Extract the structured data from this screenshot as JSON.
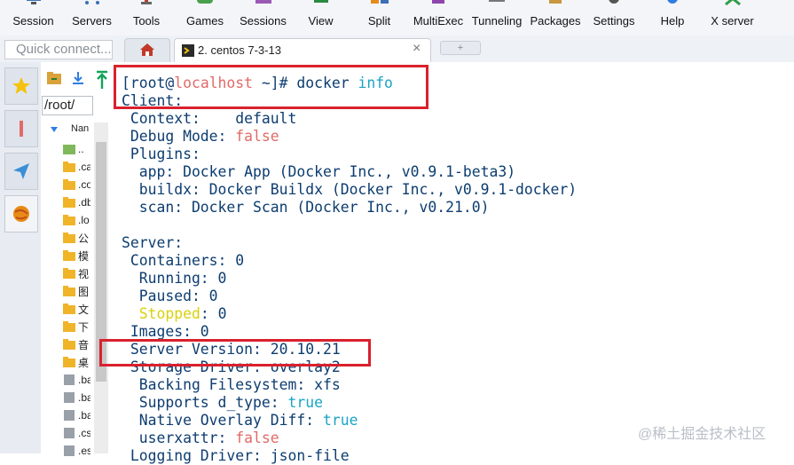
{
  "toolbar": {
    "items": [
      {
        "label": "Session",
        "icon": "session-icon"
      },
      {
        "label": "Servers",
        "icon": "servers-icon"
      },
      {
        "label": "Tools",
        "icon": "tools-icon"
      },
      {
        "label": "Games",
        "icon": "games-icon"
      },
      {
        "label": "Sessions",
        "icon": "sessions-icon"
      },
      {
        "label": "View",
        "icon": "view-icon"
      },
      {
        "label": "Split",
        "icon": "split-icon"
      },
      {
        "label": "MultiExec",
        "icon": "multiexec-icon"
      },
      {
        "label": "Tunneling",
        "icon": "tunneling-icon"
      },
      {
        "label": "Packages",
        "icon": "packages-icon"
      },
      {
        "label": "Settings",
        "icon": "settings-icon"
      },
      {
        "label": "Help",
        "icon": "help-icon"
      },
      {
        "label": "X server",
        "icon": "x-server-icon"
      }
    ]
  },
  "quick_connect": {
    "placeholder": "Quick connect..."
  },
  "tabs": {
    "home_icon": "home-icon",
    "active_title": "2. centos 7-3-13",
    "close": "×",
    "new_tab": "+"
  },
  "file_browser": {
    "path": "/root/",
    "column_name": "Nan",
    "files": [
      {
        "name": "..",
        "icon": "parent-folder-icon"
      },
      {
        "name": ".ca",
        "icon": "folder-icon"
      },
      {
        "name": ".co",
        "icon": "folder-icon"
      },
      {
        "name": ".db",
        "icon": "folder-icon"
      },
      {
        "name": ".lo",
        "icon": "folder-icon"
      },
      {
        "name": "公",
        "icon": "folder-icon"
      },
      {
        "name": "模",
        "icon": "folder-icon"
      },
      {
        "name": "视",
        "icon": "folder-icon"
      },
      {
        "name": "图",
        "icon": "folder-icon"
      },
      {
        "name": "文",
        "icon": "folder-icon"
      },
      {
        "name": "下",
        "icon": "folder-icon"
      },
      {
        "name": "音",
        "icon": "folder-icon"
      },
      {
        "name": "桌",
        "icon": "folder-icon"
      },
      {
        "name": ".ba",
        "icon": "file-icon"
      },
      {
        "name": ".ba",
        "icon": "file-icon"
      },
      {
        "name": ".ba",
        "icon": "file-icon"
      },
      {
        "name": ".cs",
        "icon": "file-icon"
      },
      {
        "name": ".es",
        "icon": "file-icon"
      }
    ]
  },
  "terminal": {
    "lines": [
      [
        {
          "t": "[root@"
        },
        {
          "t": "localhost",
          "c": "host"
        },
        {
          "t": " ~]# docker "
        },
        {
          "t": "info",
          "c": "cyan"
        }
      ],
      [
        {
          "t": "Client:"
        }
      ],
      [
        {
          "t": " Context:    default"
        }
      ],
      [
        {
          "t": " Debug Mode: "
        },
        {
          "t": "false",
          "c": "red"
        }
      ],
      [
        {
          "t": " Plugins:"
        }
      ],
      [
        {
          "t": "  app: Docker App (Docker Inc., v0.9.1-beta3)"
        }
      ],
      [
        {
          "t": "  buildx: Docker Buildx (Docker Inc., v0.9.1-docker)"
        }
      ],
      [
        {
          "t": "  scan: Docker Scan (Docker Inc., v0.21.0)"
        }
      ],
      [
        {
          "t": ""
        }
      ],
      [
        {
          "t": "Server:"
        }
      ],
      [
        {
          "t": " Containers: 0"
        }
      ],
      [
        {
          "t": "  Running: 0"
        }
      ],
      [
        {
          "t": "  Paused: 0"
        }
      ],
      [
        {
          "t": "  "
        },
        {
          "t": "Stopped",
          "c": "yellow"
        },
        {
          "t": ": 0"
        }
      ],
      [
        {
          "t": " Images: 0"
        }
      ],
      [
        {
          "t": " Server Version: 20.10.21"
        }
      ],
      [
        {
          "t": " Storage Driver: overlay2"
        }
      ],
      [
        {
          "t": "  Backing Filesystem: xfs"
        }
      ],
      [
        {
          "t": "  Supports d_type: "
        },
        {
          "t": "true",
          "c": "cyan"
        }
      ],
      [
        {
          "t": "  Native Overlay Diff: "
        },
        {
          "t": "true",
          "c": "cyan"
        }
      ],
      [
        {
          "t": "  userxattr: "
        },
        {
          "t": "false",
          "c": "red"
        }
      ],
      [
        {
          "t": " Logging Driver: json-file"
        }
      ]
    ]
  },
  "watermark": "@稀土掘金技术社区",
  "colors": {
    "highlight_box": "#d9212d",
    "terminal_text": "#0d3d70",
    "keyword_cyan": "#1aa4c4",
    "host_red": "#e06b67",
    "stopped_yellow": "#d8d10c"
  }
}
